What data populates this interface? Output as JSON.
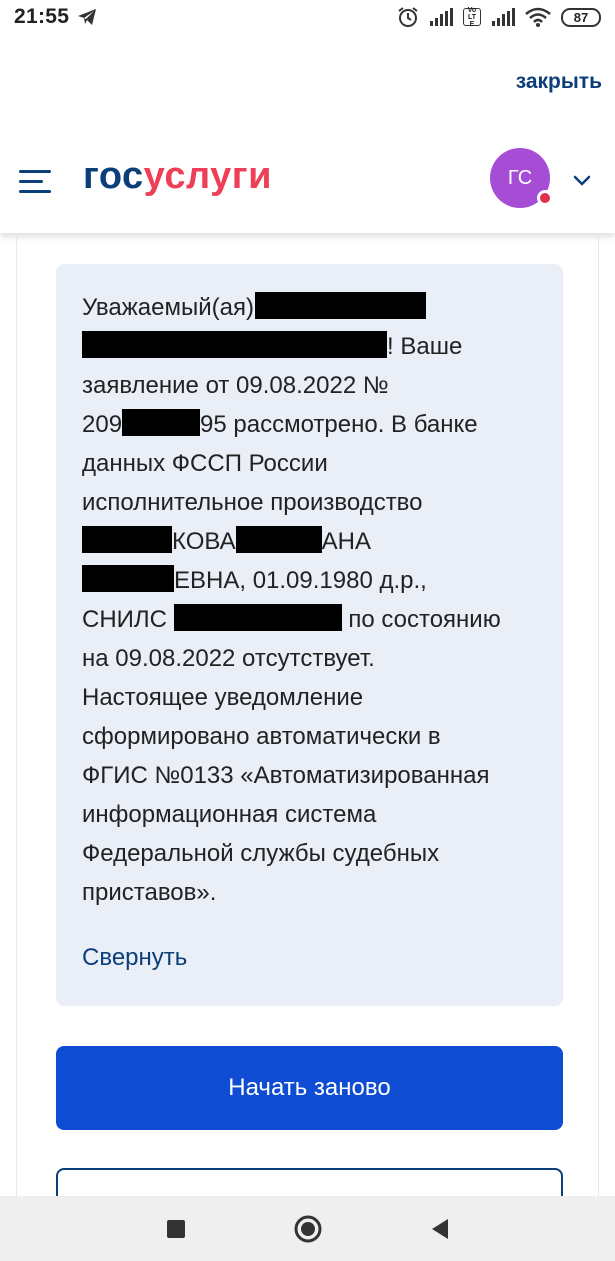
{
  "status_bar": {
    "time": "21:55",
    "volte_label": "VoLTE",
    "battery": "87",
    "icons": [
      "telegram-icon",
      "alarm-icon",
      "signal-icon",
      "volte-icon",
      "signal-icon",
      "wifi-icon",
      "battery-icon"
    ]
  },
  "close_label": "закрыть",
  "header": {
    "logo_part1": "гос",
    "logo_part2": "услуги",
    "avatar_initials": "ГС",
    "colors": {
      "brand_dark": "#0b3f7a",
      "brand_red": "#ee3f58",
      "avatar": "#a64dd6"
    }
  },
  "message": {
    "line1": "Уважаемый(ая)",
    "line2_after": "! Ваше",
    "line3": "заявление от 09.08.2022 №",
    "line4_before": "209",
    "line4_after": "95 рассмотрено. В банке",
    "line5": "данных ФССП России",
    "line6": "исполнительное производство",
    "line7_mid1": "КОВА",
    "line7_mid2": "АНА",
    "line8_after": "ЕВНА, 01.09.1980 д.р.,",
    "line9_before": "СНИЛС",
    "line9_after": "по состоянию",
    "line10": "на 09.08.2022 отсутствует.",
    "line11": "Настоящее уведомление",
    "line12": "сформировано автоматически в",
    "line13": "ФГИС №0133 «Автоматизированная",
    "line14": "информационная система",
    "line15": "Федеральной службы судебных",
    "line16": "приставов».",
    "collapse_label": "Свернуть"
  },
  "actions": {
    "restart_label": "Начать заново",
    "colors": {
      "primary": "#0d4cd3",
      "card_bg": "#e9eef7"
    }
  },
  "nav_bar": {
    "icons": [
      "square-icon",
      "circle-icon",
      "back-triangle-icon"
    ]
  }
}
